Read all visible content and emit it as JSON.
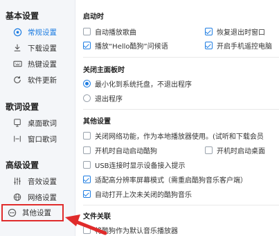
{
  "sidebar": {
    "sections": [
      {
        "title": "基本设置",
        "items": [
          {
            "label": "常规设置",
            "icon": "gear-icon"
          },
          {
            "label": "下载设置",
            "icon": "download-icon"
          },
          {
            "label": "热键设置",
            "icon": "keyboard-icon"
          },
          {
            "label": "软件更新",
            "icon": "refresh-icon"
          }
        ]
      },
      {
        "title": "歌词设置",
        "items": [
          {
            "label": "桌面歌词",
            "icon": "desktop-lyric-icon"
          },
          {
            "label": "窗口歌词",
            "icon": "window-lyric-icon"
          }
        ]
      },
      {
        "title": "高级设置",
        "items": [
          {
            "label": "音效设置",
            "icon": "equalizer-icon"
          },
          {
            "label": "网络设置",
            "icon": "globe-icon"
          },
          {
            "label": "其他设置",
            "icon": "more-icon"
          }
        ]
      }
    ],
    "active_color": "#1e7de2"
  },
  "content": {
    "startup": {
      "title": "启动时",
      "auto_play": "自动播放歌曲",
      "restore_last": "恢复退出时窗口",
      "play_greeting": "播放“Hello酷狗”问候语",
      "open_remote": "开启手机遥控电脑"
    },
    "close_panel": {
      "title": "关闭主面板时",
      "minimize_tray": "最小化到系统托盘，不退出程序",
      "exit_program": "退出程序"
    },
    "other": {
      "title": "其他设置",
      "close_network": "关闭网络功能，作为本地播放器使用。(试听和下载会员",
      "auto_start": "开机时自动启动酷狗",
      "auto_start_desktop": "开机时启动桌面",
      "usb_prompt": "USB连接时显示设备接入提示",
      "high_dpi": "适配高分辨率屏幕模式（需重启酷狗音乐客户端）",
      "auto_open_music": "自动打开上次未关闭的酷狗音乐"
    },
    "file_assoc": {
      "title": "文件关联",
      "default_player": "将酷狗作为默认音乐播放器"
    }
  },
  "highlight_color": "#e02b2b"
}
